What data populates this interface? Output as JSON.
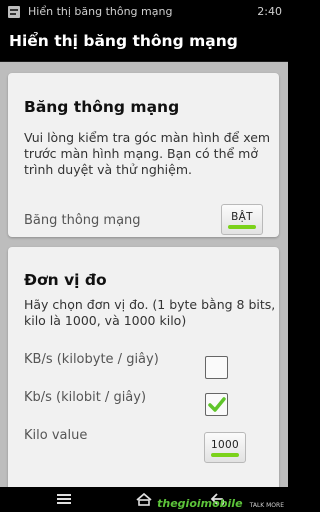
{
  "status_bar": {
    "notification_text": "Hiển thị băng thông mạng",
    "time": "2:40"
  },
  "action_bar": {
    "title": "Hiển thị băng thông mạng"
  },
  "bandwidth_card": {
    "title": "Băng thông mạng",
    "description": "Vui lòng kiểm tra góc màn hình để xem trước màn hình mạng. Bạn có thể mở trình duyệt và thử nghiệm.",
    "toggle_label": "Băng thông mạng",
    "toggle_button": "BẬT",
    "toggle_on": true
  },
  "unit_card": {
    "title": "Đơn vị đo",
    "description": "Hãy chọn đơn vị đo. (1 byte bằng 8 bits, kilo là 1000, và 1000 kilo)",
    "options": [
      {
        "label": "KB/s (kilobyte / giây)",
        "checked": false
      },
      {
        "label": "Kb/s (kilobit / giây)",
        "checked": true
      }
    ],
    "kilo_label": "Kilo value",
    "kilo_value": "1000"
  },
  "watermark": {
    "brand": "thegioimobile",
    "tagline": "TALK MORE"
  },
  "colors": {
    "accent_green": "#7bd21a",
    "check_green": "#5fc52a",
    "card_bg": "#f1f1f1",
    "content_bg": "#bdbdbd"
  }
}
